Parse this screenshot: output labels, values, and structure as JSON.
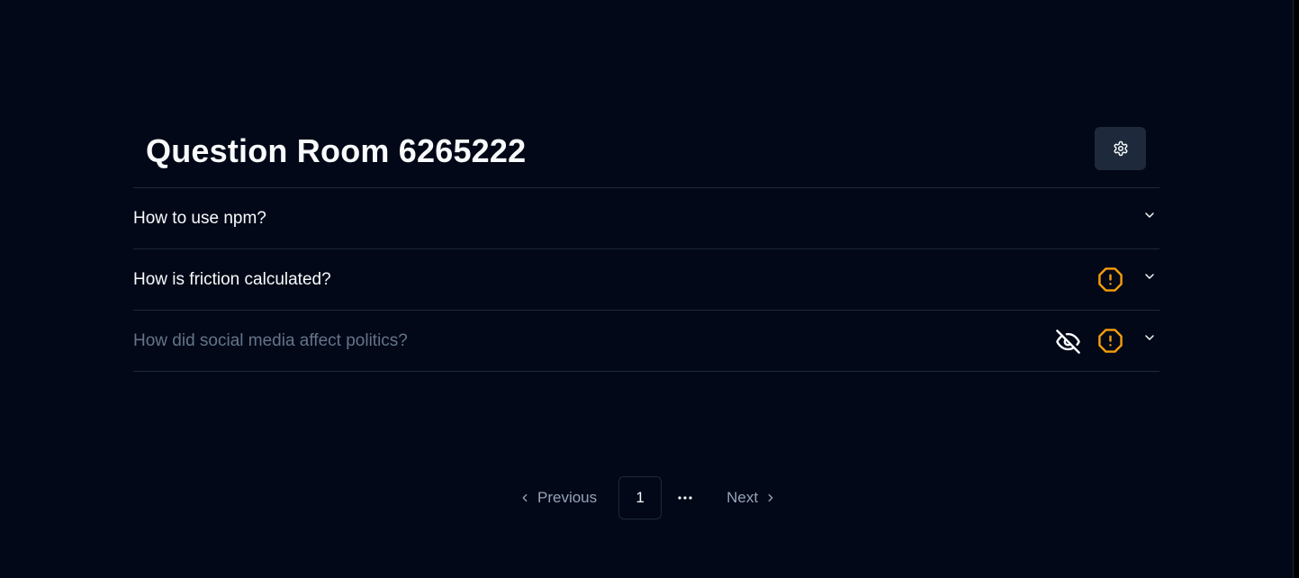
{
  "header": {
    "title": "Question Room 6265222",
    "settings_icon": "gear-icon"
  },
  "questions": [
    {
      "text": "How to use npm?",
      "hidden": false,
      "flagged": false,
      "expand_icon": "chevron-down-icon"
    },
    {
      "text": "How is friction calculated?",
      "hidden": false,
      "flagged": true,
      "flag_icon": "alert-octagon-icon",
      "expand_icon": "chevron-down-icon"
    },
    {
      "text": "How did social media affect politics?",
      "hidden": true,
      "hidden_icon": "eye-off-icon",
      "flagged": true,
      "flag_icon": "alert-octagon-icon",
      "expand_icon": "chevron-down-icon"
    }
  ],
  "pagination": {
    "previous_label": "Previous",
    "current_page": "1",
    "next_label": "Next"
  },
  "colors": {
    "background": "#020817",
    "border": "#1e293b",
    "settings_button": "#1e293b",
    "warning": "#f59e0b",
    "muted_text": "#64748b",
    "text": "#f8fafc"
  }
}
